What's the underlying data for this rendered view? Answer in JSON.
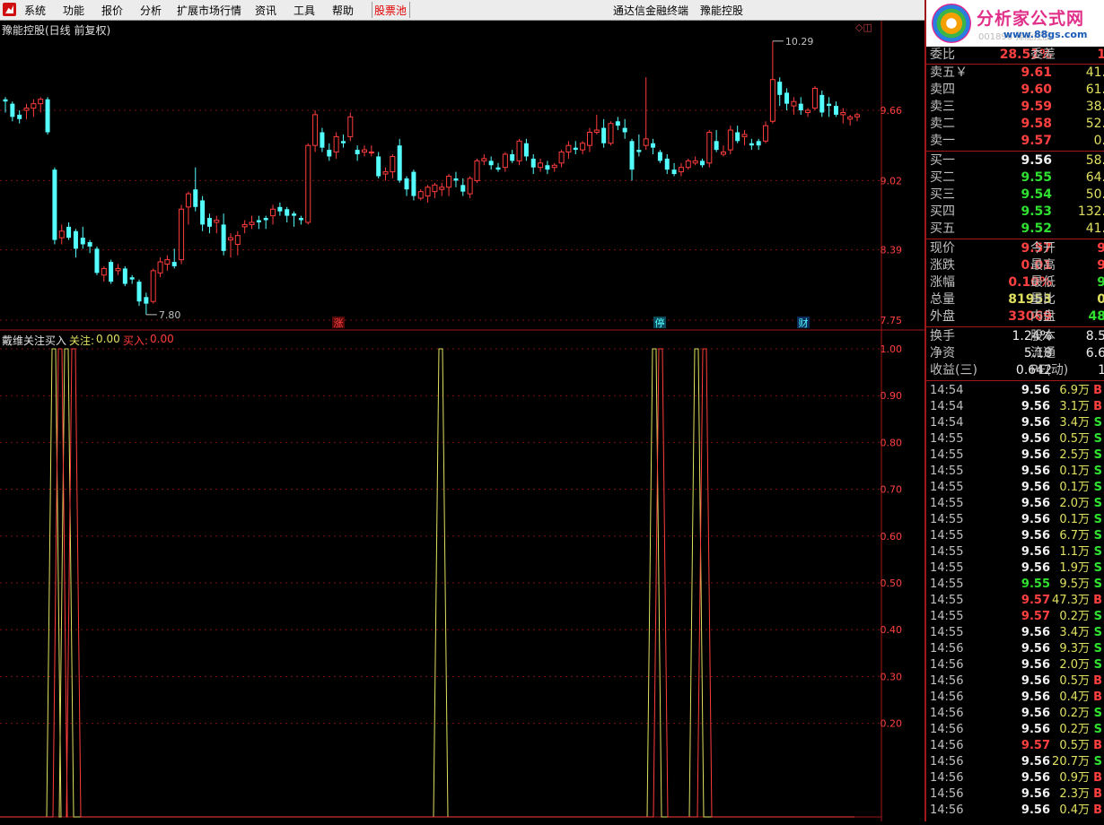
{
  "menu": {
    "items": [
      "系统",
      "功能",
      "报价",
      "分析",
      "扩展市场行情",
      "资讯",
      "工具",
      "帮助"
    ],
    "stock_pool": "股票池",
    "terminal": "通达信金融终端",
    "stock_name": "豫能控股"
  },
  "chart": {
    "title": "豫能控股(日线 前复权)",
    "price_ticks": [
      "9.66",
      "9.02",
      "8.39",
      "7.75"
    ],
    "high_label": "10.29",
    "low_label": "7.80",
    "event_markers": [
      "涨",
      "停",
      "财"
    ],
    "colors": {
      "up": "#ff3c3c",
      "down": "#54ffff",
      "grid": "#7a1010",
      "frame": "#a01818"
    }
  },
  "indicator": {
    "name": "戴维关注买入",
    "line1_label": "关注:",
    "line1_value": "0.00",
    "line2_label": "买入:",
    "line2_value": "0.00",
    "ticks": [
      "1.00",
      "0.90",
      "0.80",
      "0.70",
      "0.60",
      "0.50",
      "0.40",
      "0.30",
      "0.20"
    ],
    "colors": {
      "guanzhu": "#e0e060",
      "mairu": "#ff3c3c"
    }
  },
  "logo": {
    "name": "分析家公式网",
    "url": "www.88gs.com",
    "ghost": "001896 豫能控股"
  },
  "quote": {
    "header": {
      "label": "委比",
      "value": "28.51%",
      "label2": "委差",
      "value2": "1"
    },
    "sell": [
      {
        "label": "卖五￥",
        "price": "9.61",
        "vol": "41."
      },
      {
        "label": "卖四",
        "price": "9.60",
        "vol": "61."
      },
      {
        "label": "卖三",
        "price": "9.59",
        "vol": "38."
      },
      {
        "label": "卖二",
        "price": "9.58",
        "vol": "52."
      },
      {
        "label": "卖一",
        "price": "9.57",
        "vol": "0."
      }
    ],
    "buy": [
      {
        "label": "买一",
        "price": "9.56",
        "vol": "58."
      },
      {
        "label": "买二",
        "price": "9.55",
        "vol": "64."
      },
      {
        "label": "买三",
        "price": "9.54",
        "vol": "50."
      },
      {
        "label": "买四",
        "price": "9.53",
        "vol": "132."
      },
      {
        "label": "买五",
        "price": "9.52",
        "vol": "41."
      }
    ],
    "stats": [
      {
        "l1": "现价",
        "v1": "9.57",
        "l2": "今开",
        "v2": "9"
      },
      {
        "l1": "涨跌",
        "v1": "0.01",
        "l2": "最高",
        "v2": "9"
      },
      {
        "l1": "涨幅",
        "v1": "0.10%",
        "l2": "最低",
        "v2": "9"
      },
      {
        "l1": "总量",
        "v1": "81953",
        "l2": "量比",
        "v2": "0"
      },
      {
        "l1": "外盘",
        "v1": "33069",
        "l2": "内盘",
        "v2": "48"
      }
    ],
    "fin": [
      {
        "l1": "换手",
        "v1": "1.24%",
        "l2": "股本",
        "v2": "8.5"
      },
      {
        "l1": "净资",
        "v1": "5.18",
        "l2": "流通",
        "v2": "6.6"
      },
      {
        "l1": "收益(三)",
        "v1": "0.642",
        "l2": "PE(动)",
        "v2": "1"
      }
    ]
  },
  "ticks": [
    {
      "t": "14:54",
      "p": "9.56",
      "v": "6.9万",
      "d": "B",
      "pc": "w"
    },
    {
      "t": "14:54",
      "p": "9.56",
      "v": "3.1万",
      "d": "B",
      "pc": "w"
    },
    {
      "t": "14:54",
      "p": "9.56",
      "v": "3.4万",
      "d": "S",
      "pc": "w"
    },
    {
      "t": "14:55",
      "p": "9.56",
      "v": "0.5万",
      "d": "S",
      "pc": "w"
    },
    {
      "t": "14:55",
      "p": "9.56",
      "v": "2.5万",
      "d": "S",
      "pc": "w"
    },
    {
      "t": "14:55",
      "p": "9.56",
      "v": "0.1万",
      "d": "S",
      "pc": "w"
    },
    {
      "t": "14:55",
      "p": "9.56",
      "v": "0.1万",
      "d": "S",
      "pc": "w"
    },
    {
      "t": "14:55",
      "p": "9.56",
      "v": "2.0万",
      "d": "S",
      "pc": "w"
    },
    {
      "t": "14:55",
      "p": "9.56",
      "v": "0.1万",
      "d": "S",
      "pc": "w"
    },
    {
      "t": "14:55",
      "p": "9.56",
      "v": "6.7万",
      "d": "S",
      "pc": "w"
    },
    {
      "t": "14:55",
      "p": "9.56",
      "v": "1.1万",
      "d": "S",
      "pc": "w"
    },
    {
      "t": "14:55",
      "p": "9.56",
      "v": "1.9万",
      "d": "S",
      "pc": "w"
    },
    {
      "t": "14:55",
      "p": "9.55",
      "v": "9.5万",
      "d": "S",
      "pc": "g"
    },
    {
      "t": "14:55",
      "p": "9.57",
      "v": "47.3万",
      "d": "B",
      "pc": "r"
    },
    {
      "t": "14:55",
      "p": "9.57",
      "v": "0.2万",
      "d": "S",
      "pc": "r"
    },
    {
      "t": "14:55",
      "p": "9.56",
      "v": "3.4万",
      "d": "S",
      "pc": "w"
    },
    {
      "t": "14:56",
      "p": "9.56",
      "v": "9.3万",
      "d": "S",
      "pc": "w"
    },
    {
      "t": "14:56",
      "p": "9.56",
      "v": "2.0万",
      "d": "S",
      "pc": "w"
    },
    {
      "t": "14:56",
      "p": "9.56",
      "v": "0.5万",
      "d": "B",
      "pc": "w"
    },
    {
      "t": "14:56",
      "p": "9.56",
      "v": "0.4万",
      "d": "B",
      "pc": "w"
    },
    {
      "t": "14:56",
      "p": "9.56",
      "v": "0.2万",
      "d": "S",
      "pc": "w"
    },
    {
      "t": "14:56",
      "p": "9.56",
      "v": "0.2万",
      "d": "S",
      "pc": "w"
    },
    {
      "t": "14:56",
      "p": "9.57",
      "v": "0.5万",
      "d": "B",
      "pc": "r"
    },
    {
      "t": "14:56",
      "p": "9.56",
      "v": "20.7万",
      "d": "S",
      "pc": "w"
    },
    {
      "t": "14:56",
      "p": "9.56",
      "v": "0.9万",
      "d": "B",
      "pc": "w"
    },
    {
      "t": "14:56",
      "p": "9.56",
      "v": "2.3万",
      "d": "B",
      "pc": "w"
    },
    {
      "t": "14:56",
      "p": "9.56",
      "v": "0.4万",
      "d": "B",
      "pc": "w"
    }
  ],
  "chart_data": {
    "type": "candlestick",
    "candles": [
      [
        9.76,
        9.78,
        9.64,
        9.74
      ],
      [
        9.72,
        9.74,
        9.56,
        9.6
      ],
      [
        9.62,
        9.66,
        9.54,
        9.58
      ],
      [
        9.66,
        9.72,
        9.58,
        9.68
      ],
      [
        9.68,
        9.76,
        9.6,
        9.72
      ],
      [
        9.72,
        9.78,
        9.64,
        9.76
      ],
      [
        9.76,
        9.78,
        9.44,
        9.46
      ],
      [
        9.12,
        9.14,
        8.44,
        8.48
      ],
      [
        8.5,
        8.62,
        8.44,
        8.56
      ],
      [
        8.6,
        8.64,
        8.48,
        8.5
      ],
      [
        8.56,
        8.58,
        8.32,
        8.4
      ],
      [
        8.5,
        8.6,
        8.4,
        8.44
      ],
      [
        8.46,
        8.48,
        8.36,
        8.42
      ],
      [
        8.4,
        8.42,
        8.16,
        8.18
      ],
      [
        8.16,
        8.24,
        8.1,
        8.22
      ],
      [
        8.28,
        8.3,
        8.08,
        8.1
      ],
      [
        8.2,
        8.26,
        8.16,
        8.22
      ],
      [
        8.22,
        8.24,
        8.06,
        8.08
      ],
      [
        8.14,
        8.16,
        8.08,
        8.12
      ],
      [
        8.1,
        8.12,
        7.88,
        7.92
      ],
      [
        7.96,
        8.0,
        7.8,
        7.9
      ],
      [
        7.92,
        8.22,
        7.9,
        8.2
      ],
      [
        8.18,
        8.32,
        8.14,
        8.28
      ],
      [
        8.26,
        8.34,
        8.2,
        8.3
      ],
      [
        8.28,
        8.4,
        8.22,
        8.24
      ],
      [
        8.3,
        8.8,
        8.26,
        8.76
      ],
      [
        8.78,
        8.92,
        8.62,
        8.9
      ],
      [
        8.94,
        9.14,
        8.74,
        8.78
      ],
      [
        8.84,
        8.88,
        8.56,
        8.62
      ],
      [
        8.68,
        8.72,
        8.54,
        8.6
      ],
      [
        8.64,
        8.7,
        8.54,
        8.66
      ],
      [
        8.62,
        8.72,
        8.34,
        8.38
      ],
      [
        8.48,
        8.54,
        8.32,
        8.5
      ],
      [
        8.44,
        8.56,
        8.34,
        8.52
      ],
      [
        8.6,
        8.66,
        8.54,
        8.62
      ],
      [
        8.62,
        8.7,
        8.58,
        8.64
      ],
      [
        8.66,
        8.7,
        8.58,
        8.64
      ],
      [
        8.68,
        8.7,
        8.58,
        8.66
      ],
      [
        8.7,
        8.8,
        8.62,
        8.76
      ],
      [
        8.78,
        8.82,
        8.7,
        8.74
      ],
      [
        8.76,
        8.78,
        8.64,
        8.7
      ],
      [
        8.72,
        8.74,
        8.6,
        8.7
      ],
      [
        8.68,
        8.7,
        8.62,
        8.66
      ],
      [
        8.64,
        9.36,
        8.62,
        9.34
      ],
      [
        9.34,
        9.66,
        9.28,
        9.62
      ],
      [
        9.46,
        9.5,
        9.28,
        9.32
      ],
      [
        9.3,
        9.36,
        9.2,
        9.24
      ],
      [
        9.28,
        9.46,
        9.22,
        9.42
      ],
      [
        9.38,
        9.44,
        9.32,
        9.36
      ],
      [
        9.42,
        9.64,
        9.38,
        9.6
      ],
      [
        9.3,
        9.34,
        9.2,
        9.26
      ],
      [
        9.28,
        9.34,
        9.24,
        9.3
      ],
      [
        9.28,
        9.34,
        9.24,
        9.28
      ],
      [
        9.24,
        9.28,
        9.04,
        9.06
      ],
      [
        9.08,
        9.14,
        9.02,
        9.1
      ],
      [
        9.1,
        9.26,
        9.04,
        9.24
      ],
      [
        9.34,
        9.4,
        9.0,
        9.02
      ],
      [
        9.04,
        9.06,
        8.88,
        8.94
      ],
      [
        9.1,
        9.12,
        8.84,
        8.88
      ],
      [
        8.86,
        8.94,
        8.84,
        8.92
      ],
      [
        8.88,
        8.98,
        8.82,
        8.96
      ],
      [
        8.92,
        9.0,
        8.86,
        8.98
      ],
      [
        8.94,
        9.0,
        8.88,
        8.96
      ],
      [
        8.96,
        9.08,
        8.88,
        9.06
      ],
      [
        9.04,
        9.1,
        8.96,
        9.02
      ],
      [
        8.98,
        9.04,
        8.88,
        8.92
      ],
      [
        8.9,
        9.06,
        8.86,
        9.04
      ],
      [
        9.02,
        9.22,
        9.0,
        9.2
      ],
      [
        9.2,
        9.26,
        9.16,
        9.22
      ],
      [
        9.2,
        9.24,
        9.12,
        9.16
      ],
      [
        9.14,
        9.18,
        9.1,
        9.12
      ],
      [
        9.14,
        9.28,
        9.1,
        9.26
      ],
      [
        9.26,
        9.3,
        9.18,
        9.2
      ],
      [
        9.2,
        9.4,
        9.16,
        9.38
      ],
      [
        9.36,
        9.4,
        9.2,
        9.24
      ],
      [
        9.22,
        9.26,
        9.08,
        9.14
      ],
      [
        9.14,
        9.22,
        9.1,
        9.18
      ],
      [
        9.16,
        9.2,
        9.08,
        9.12
      ],
      [
        9.14,
        9.18,
        9.1,
        9.16
      ],
      [
        9.18,
        9.3,
        9.14,
        9.28
      ],
      [
        9.28,
        9.38,
        9.22,
        9.34
      ],
      [
        9.32,
        9.38,
        9.26,
        9.3
      ],
      [
        9.3,
        9.38,
        9.26,
        9.36
      ],
      [
        9.34,
        9.5,
        9.28,
        9.46
      ],
      [
        9.46,
        9.62,
        9.44,
        9.48
      ],
      [
        9.5,
        9.58,
        9.32,
        9.36
      ],
      [
        9.36,
        9.56,
        9.34,
        9.54
      ],
      [
        9.56,
        9.6,
        9.48,
        9.52
      ],
      [
        9.5,
        9.58,
        9.4,
        9.46
      ],
      [
        9.38,
        9.4,
        9.02,
        9.12
      ],
      [
        9.3,
        9.44,
        9.24,
        9.28
      ],
      [
        9.34,
        9.96,
        9.3,
        9.4
      ],
      [
        9.36,
        9.4,
        9.26,
        9.32
      ],
      [
        9.28,
        9.3,
        9.18,
        9.2
      ],
      [
        9.22,
        9.26,
        9.08,
        9.12
      ],
      [
        9.12,
        9.18,
        9.06,
        9.08
      ],
      [
        9.1,
        9.18,
        9.06,
        9.14
      ],
      [
        9.14,
        9.22,
        9.12,
        9.2
      ],
      [
        9.18,
        9.24,
        9.16,
        9.2
      ],
      [
        9.2,
        9.22,
        9.14,
        9.16
      ],
      [
        9.18,
        9.48,
        9.14,
        9.46
      ],
      [
        9.38,
        9.48,
        9.28,
        9.3
      ],
      [
        9.26,
        9.34,
        9.24,
        9.28
      ],
      [
        9.3,
        9.52,
        9.26,
        9.48
      ],
      [
        9.46,
        9.52,
        9.36,
        9.38
      ],
      [
        9.42,
        9.48,
        9.34,
        9.44
      ],
      [
        9.36,
        9.4,
        9.3,
        9.34
      ],
      [
        9.38,
        9.4,
        9.3,
        9.34
      ],
      [
        9.38,
        9.56,
        9.36,
        9.52
      ],
      [
        9.56,
        10.29,
        9.54,
        9.94
      ],
      [
        9.92,
        9.96,
        9.7,
        9.8
      ],
      [
        9.82,
        9.86,
        9.66,
        9.72
      ],
      [
        9.7,
        9.78,
        9.62,
        9.74
      ],
      [
        9.72,
        9.78,
        9.62,
        9.66
      ],
      [
        9.64,
        9.68,
        9.6,
        9.66
      ],
      [
        9.68,
        9.88,
        9.66,
        9.86
      ],
      [
        9.8,
        9.84,
        9.6,
        9.64
      ],
      [
        9.72,
        9.78,
        9.6,
        9.7
      ],
      [
        9.7,
        9.74,
        9.6,
        9.62
      ],
      [
        9.62,
        9.68,
        9.54,
        9.64
      ],
      [
        9.58,
        9.62,
        9.52,
        9.6
      ],
      [
        9.6,
        9.64,
        9.56,
        9.62
      ]
    ],
    "y_ticks": [
      9.66,
      9.02,
      8.39,
      7.75
    ],
    "high": 10.29,
    "low": 7.8,
    "indicator_series": {
      "关注": {
        "spike_positions": [
          60,
          74,
          491,
          729,
          776
        ],
        "value": 1.0
      },
      "买入": {
        "spike_positions": [
          67,
          82,
          736,
          785
        ],
        "value": 1.0
      }
    },
    "indicator_y_range": [
      0,
      1.0
    ]
  }
}
